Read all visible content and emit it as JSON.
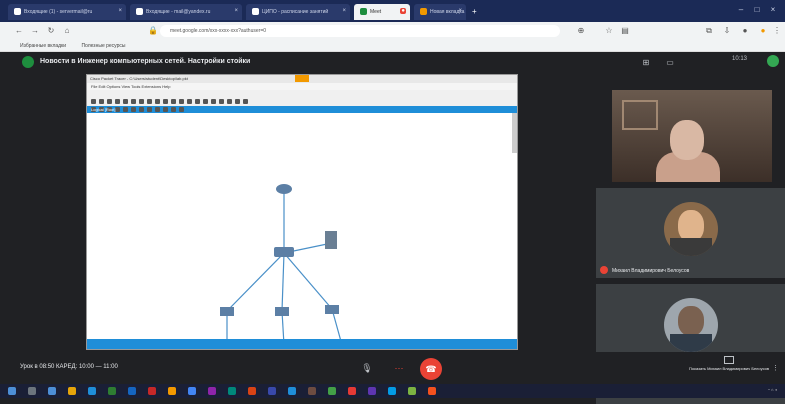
{
  "browser": {
    "tabs": [
      {
        "label": "Входящие (1) - servermail@ru"
      },
      {
        "label": "Входящие - mail@yandex.ru"
      },
      {
        "label": "ЦИПО - расписание занятий"
      },
      {
        "label": "Meet"
      },
      {
        "label": "Новая вкладка"
      }
    ],
    "url": "meet.google.com/xxx-xxxx-xxx?authuser=0",
    "bookmarks": [
      {
        "label": "Избранные вкладки"
      },
      {
        "label": "Полезные ресурсы"
      }
    ]
  },
  "meet": {
    "title": "Новости в Инженер компьютерных сетей. Настройки стойки",
    "clock": "10:13",
    "presentation": {
      "window_title": "Cisco Packet Tracer - C:\\Users\\student\\Desktop\\lab.pkt",
      "menu": "File  Edit  Options  View  Tools  Extensions  Help",
      "bluebar": "Logical  [Root]"
    },
    "participants": [
      {
        "name": ""
      },
      {
        "name": "Михаил Владимирович Белоусов"
      },
      {
        "name": ""
      }
    ],
    "meeting_info": "Урок в 08:50 КАРЕД: 10:00 — 11:00",
    "presenting_label": "Показать Михаил Владимирович Белоусов"
  }
}
